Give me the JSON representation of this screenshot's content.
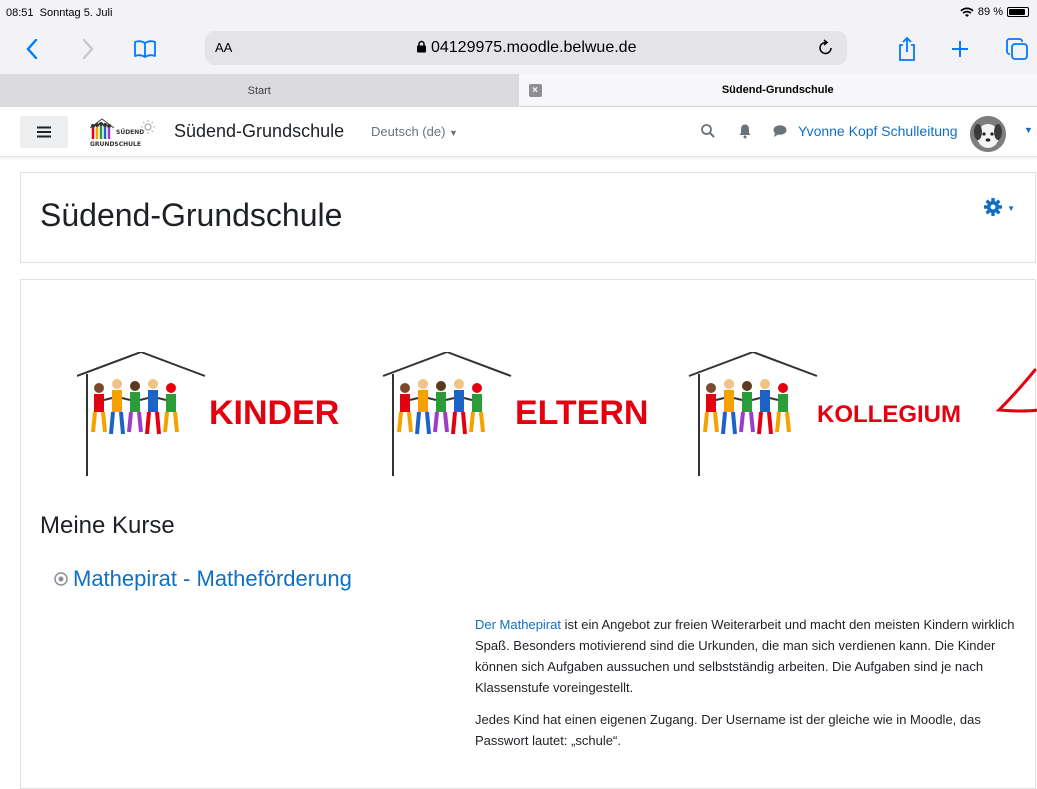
{
  "status": {
    "time": "08:51",
    "date": "Sonntag 5. Juli",
    "battery": "89 %"
  },
  "browser": {
    "aa_label": "AA",
    "url": "04129975.moodle.belwue.de",
    "tabs": [
      {
        "label": "Start",
        "active": false
      },
      {
        "label": "Südend-Grundschule",
        "active": true
      }
    ]
  },
  "navbar": {
    "site_name": "Südend-Grundschule",
    "language": "Deutsch (de)",
    "user_name": "Yvonne Kopf Schulleitung"
  },
  "header": {
    "title": "Südend-Grundschule"
  },
  "banner": {
    "items": [
      {
        "label": "KINDER",
        "color": "#e3000f"
      },
      {
        "label": "ELTERN",
        "color": "#e3000f"
      },
      {
        "label": "KOLLEGIUM",
        "color": "#e3000f"
      }
    ],
    "logo_text": "SÜDEND GRUNDSCHULE"
  },
  "courses": {
    "heading": "Meine Kurse",
    "items": [
      {
        "title": "Mathepirat - Matheförderung",
        "summary_link": "Der Mathepirat",
        "summary_p1_rest": " ist ein Angebot zur freien Weiterarbeit und macht den meisten Kindern wirklich Spaß. Besonders motivierend sind die Urkunden, die man sich verdienen kann. Die Kinder können sich Aufgaben aussuchen und selbstständig arbeiten. Die Aufgaben sind je nach Klassenstufe voreingestellt.",
        "summary_p2": "Jedes Kind hat einen eigenen Zugang. Der Username ist der gleiche wie in Moodle, das Passwort lautet: „schule“."
      }
    ]
  },
  "colors": {
    "link": "#0f6fc5",
    "ios_blue": "#007aff",
    "annotation_red": "#e3000f"
  }
}
